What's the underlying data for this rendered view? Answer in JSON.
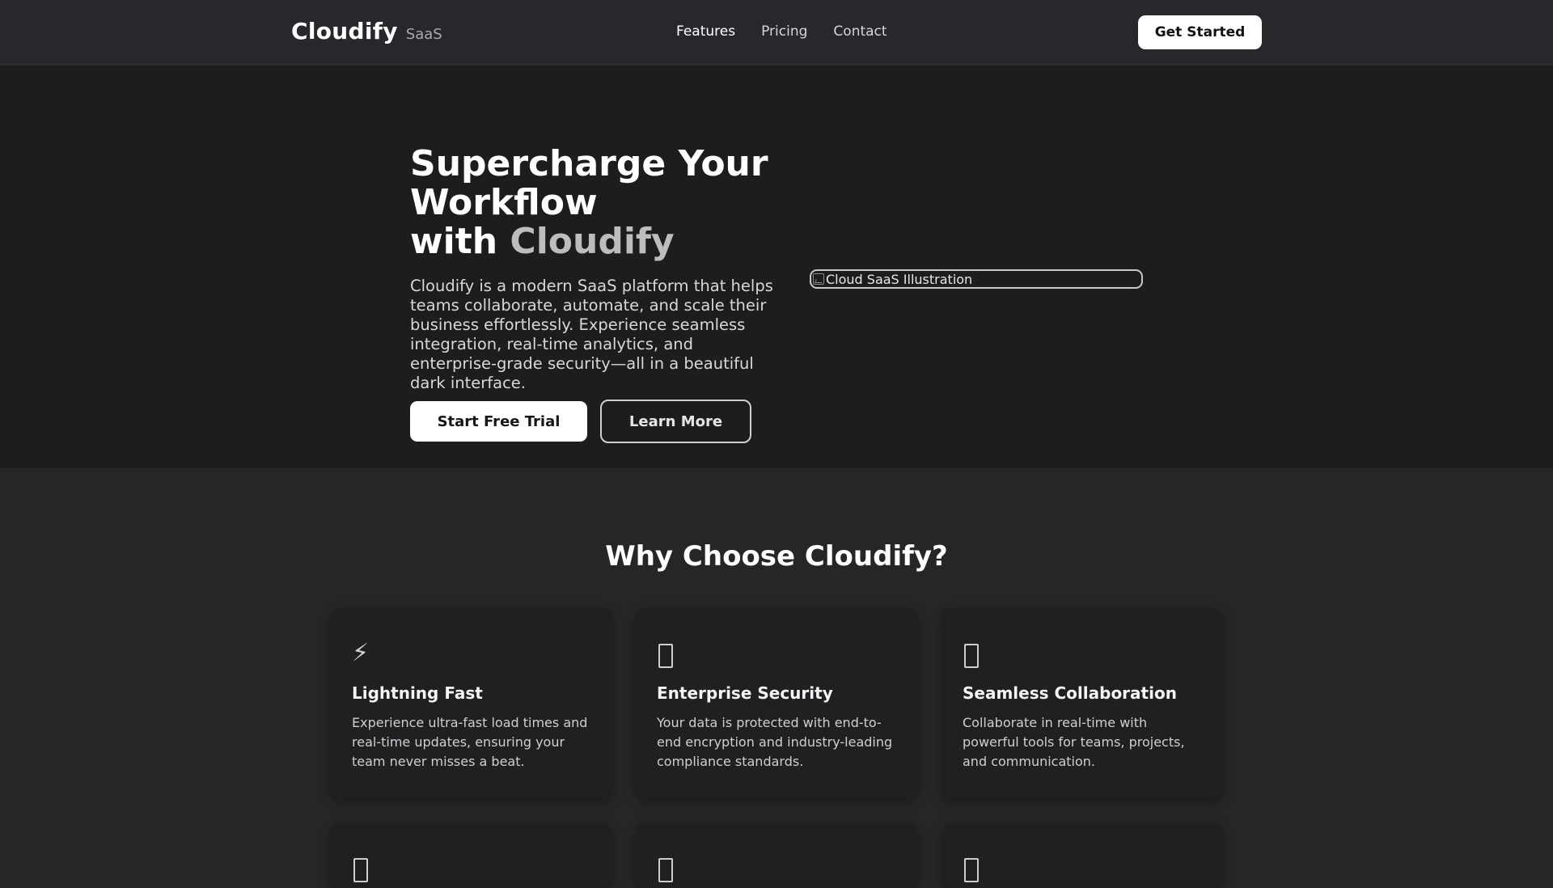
{
  "header": {
    "brand_name": "Cloudify",
    "brand_tag": "SaaS",
    "nav": [
      {
        "label": "Features",
        "active": true
      },
      {
        "label": "Pricing",
        "active": false
      },
      {
        "label": "Contact",
        "active": false
      }
    ],
    "cta_label": "Get Started"
  },
  "hero": {
    "title_line1": "Supercharge Your Workflow",
    "title_line2_prefix": "with ",
    "title_line2_accent": "Cloudify",
    "description": "Cloudify is a modern SaaS platform that helps teams collaborate, automate, and scale their business effortlessly. Experience seamless integration, real-time analytics, and enterprise-grade security—all in a beautiful dark interface.",
    "primary_button": "Start Free Trial",
    "secondary_button": "Learn More",
    "image_alt": "Cloud SaaS Illustration"
  },
  "features": {
    "title": "Why Choose Cloudify?",
    "cards": [
      {
        "icon": "lightning-icon",
        "icon_glyph": "⚡",
        "title": "Lightning Fast",
        "text": "Experience ultra-fast load times and real-time updates, ensuring your team never misses a beat."
      },
      {
        "icon": "missing-glyph-icon",
        "title": "Enterprise Security",
        "text": "Your data is protected with end-to-end encryption and industry-leading compliance standards."
      },
      {
        "icon": "missing-glyph-icon",
        "title": "Seamless Collaboration",
        "text": "Collaborate in real-time with powerful tools for teams, projects, and communication."
      },
      {
        "icon": "missing-glyph-icon"
      },
      {
        "icon": "missing-glyph-icon"
      },
      {
        "icon": "missing-glyph-icon"
      }
    ]
  },
  "colors": {
    "page_bg": "#252628",
    "hero_bg": "#1c1d1f",
    "card_bg": "#1f2022",
    "accent_text": "#bdbdbf",
    "button_bg": "#ffffff"
  }
}
